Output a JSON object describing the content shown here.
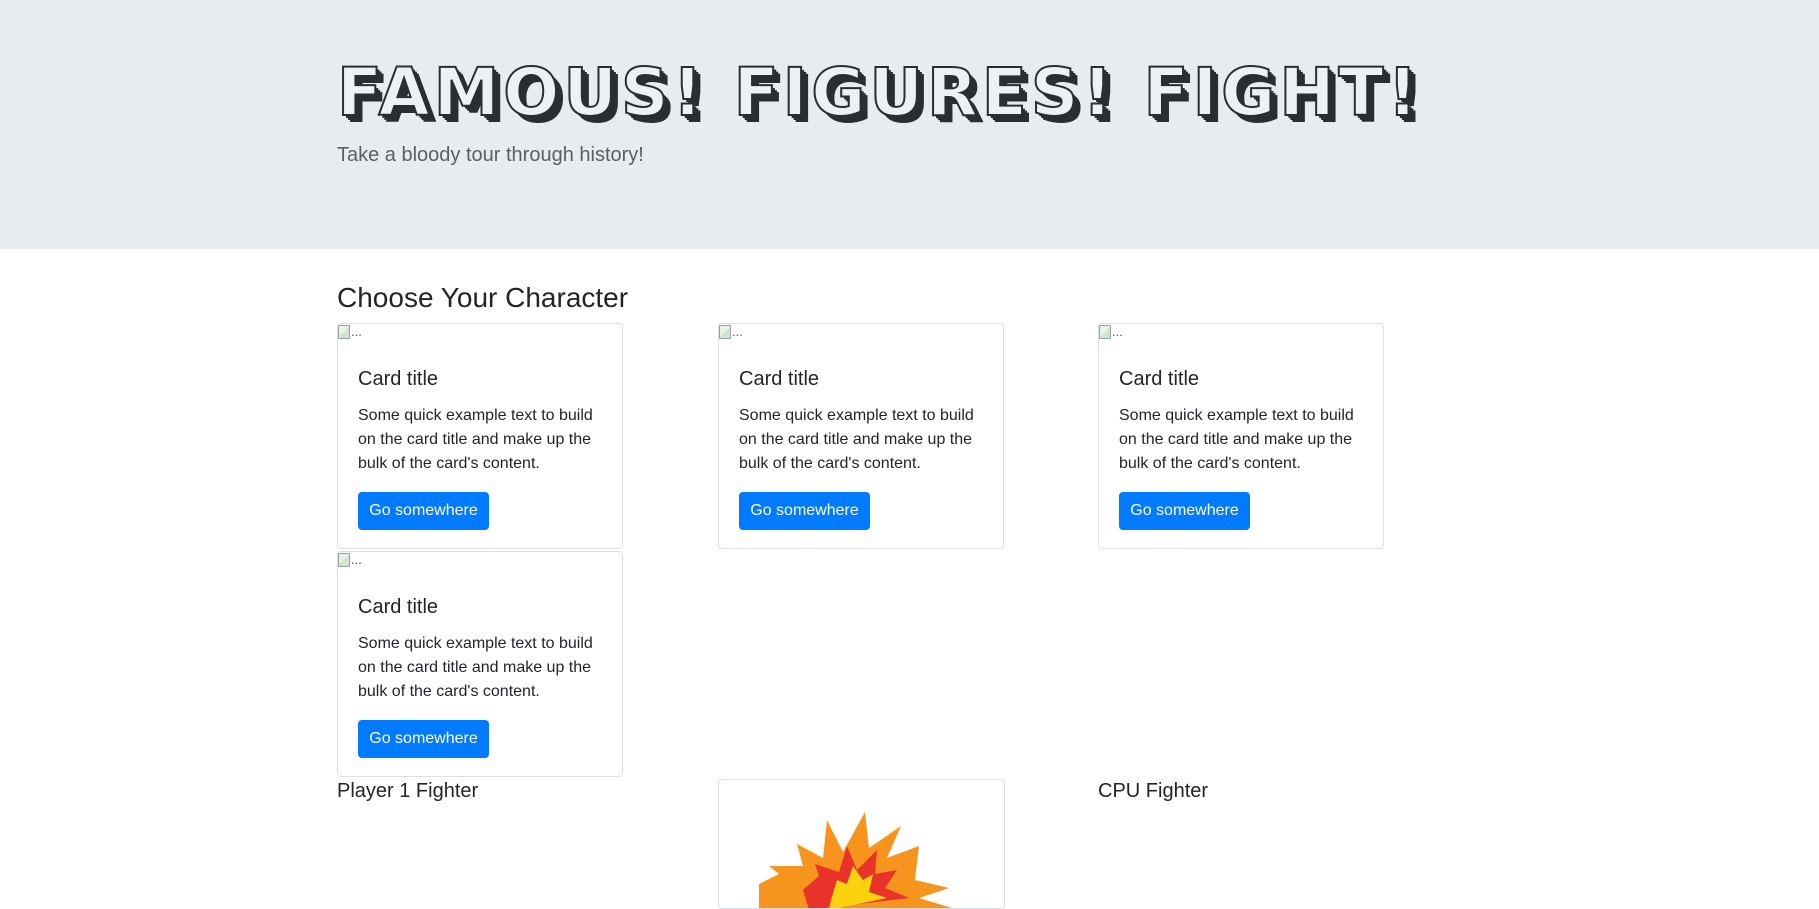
{
  "header": {
    "title": "FAMOUS! FIGURES! FIGHT!",
    "subtitle": "Take a bloody tour through history!"
  },
  "section": {
    "heading": "Choose Your Character"
  },
  "cards": [
    {
      "img_alt": "...",
      "title": "Card title",
      "text": "Some quick example text to build on the card title and make up the bulk of the card's content.",
      "button": "Go somewhere"
    },
    {
      "img_alt": "...",
      "title": "Card title",
      "text": "Some quick example text to build on the card title and make up the bulk of the card's content.",
      "button": "Go somewhere"
    },
    {
      "img_alt": "...",
      "title": "Card title",
      "text": "Some quick example text to build on the card title and make up the bulk of the card's content.",
      "button": "Go somewhere"
    },
    {
      "img_alt": "...",
      "title": "Card title",
      "text": "Some quick example text to build on the card title and make up the bulk of the card's content.",
      "button": "Go somewhere"
    }
  ],
  "arena": {
    "player_label": "Player 1 Fighter",
    "cpu_label": "CPU Fighter",
    "vs_image": "explosion-icon"
  },
  "colors": {
    "jumbotron_bg": "#e9ecef",
    "primary_button": "#007bff"
  }
}
